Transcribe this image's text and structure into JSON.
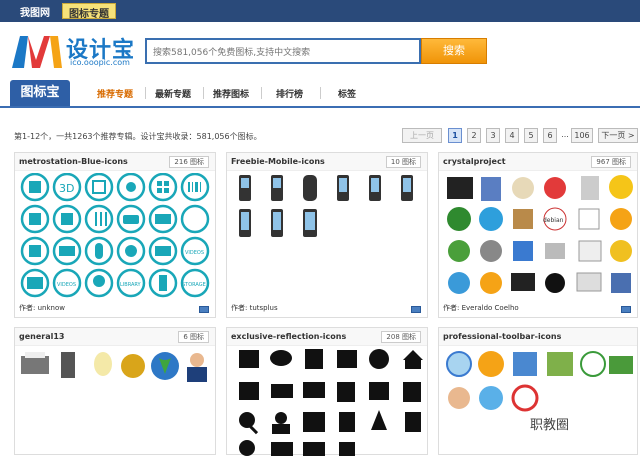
{
  "topbar": {
    "site": "我图网",
    "tab": "图标专题"
  },
  "logo": {
    "cn": "设计宝",
    "url": "ico.ooopic.com"
  },
  "search": {
    "placeholder": "搜索581,056个免费图标,支持中文搜索",
    "button": "搜索"
  },
  "nav": {
    "brand": "图标宝",
    "items": [
      "推荐专题",
      "最新专题",
      "推荐图标",
      "排行榜",
      "标签"
    ]
  },
  "summary": "第1-12个，一共1263个推荐专辑。设计宝共收录：581,056个图标。",
  "pager": {
    "prev": "上一页",
    "pages": [
      "1",
      "2",
      "3",
      "4",
      "5",
      "6",
      "...",
      "106"
    ],
    "next": "下一页 >"
  },
  "cards": [
    {
      "title": "metrostation-Blue-icons",
      "count": "216 图标",
      "author": "作者: unknow"
    },
    {
      "title": "Freebie-Mobile-icons",
      "count": "10 图标",
      "author": "作者: tutsplus"
    },
    {
      "title": "crystalproject",
      "count": "967 图标",
      "author": "作者: Everaldo Coelho"
    },
    {
      "title": "general13",
      "count": "6 图标",
      "author": ""
    },
    {
      "title": "exclusive-reflection-icons",
      "count": "208 图标",
      "author": ""
    },
    {
      "title": "professional-toolbar-icons",
      "count": "",
      "author": ""
    }
  ],
  "icon_labels": {
    "metro_video": "VIDEOS",
    "metro_library": "LIBRARY",
    "metro_storage": "STORAGE",
    "crystal_debian": "debian"
  },
  "watermark": "职教圈",
  "colors": {
    "accent": "#2e5fa6",
    "metro": "#19a7b8",
    "search_btn": "#f5a316",
    "active_nav": "#d86b00"
  }
}
